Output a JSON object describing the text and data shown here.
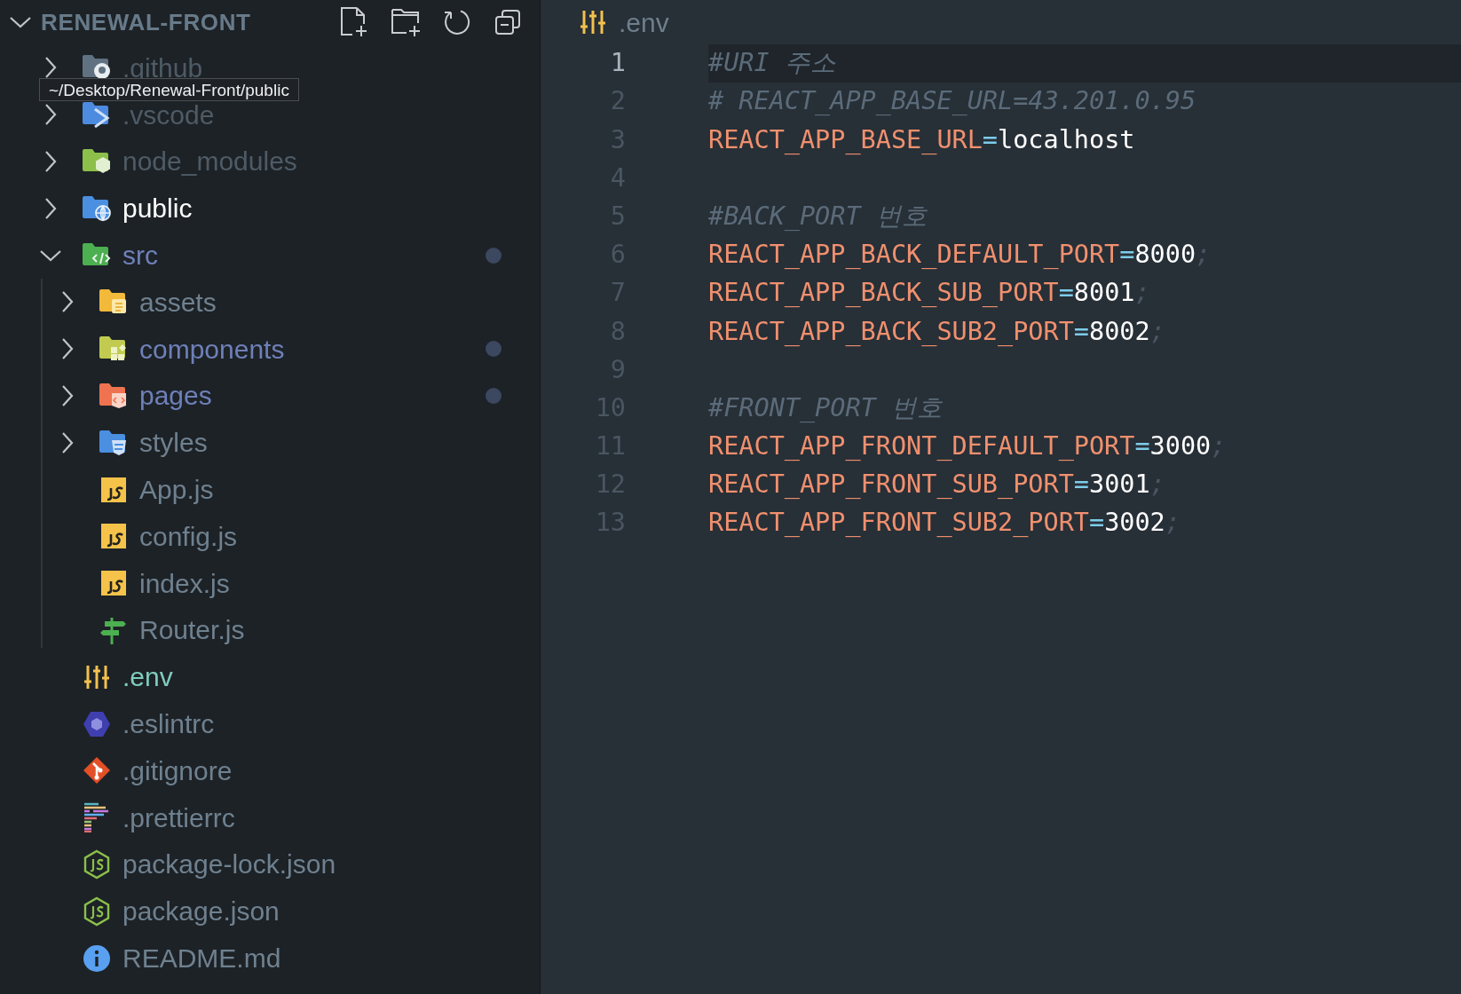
{
  "explorer": {
    "title": "RENEWAL-FRONT",
    "expanded": true
  },
  "tree": [
    {
      "label": ".github",
      "kind": "folder",
      "expanded": false,
      "ignored": true,
      "hovered": false,
      "selected": false,
      "modified": false
    },
    {
      "label": ".vscode",
      "kind": "folder",
      "expanded": false,
      "ignored": true,
      "hovered": false,
      "selected": false,
      "modified": false
    },
    {
      "label": "node_modules",
      "kind": "folder",
      "expanded": false,
      "ignored": true,
      "hovered": false,
      "selected": false,
      "modified": false
    },
    {
      "label": "public",
      "kind": "folder",
      "expanded": false,
      "ignored": false,
      "hovered": true,
      "selected": false,
      "modified": false
    },
    {
      "label": "src",
      "kind": "folder",
      "expanded": true,
      "ignored": false,
      "hovered": false,
      "selected": false,
      "modified": true,
      "children": [
        {
          "label": "assets",
          "kind": "folder",
          "expanded": false,
          "ignored": false,
          "hovered": false,
          "selected": false,
          "modified": false
        },
        {
          "label": "components",
          "kind": "folder",
          "expanded": false,
          "ignored": false,
          "hovered": false,
          "selected": false,
          "modified": true
        },
        {
          "label": "pages",
          "kind": "folder",
          "expanded": false,
          "ignored": false,
          "hovered": false,
          "selected": false,
          "modified": true
        },
        {
          "label": "styles",
          "kind": "folder",
          "expanded": false,
          "ignored": false,
          "hovered": false,
          "selected": false,
          "modified": false
        },
        {
          "label": "App.js",
          "kind": "file",
          "ignored": false,
          "hovered": false,
          "selected": false,
          "modified": false
        },
        {
          "label": "config.js",
          "kind": "file",
          "ignored": false,
          "hovered": false,
          "selected": false,
          "modified": false
        },
        {
          "label": "index.js",
          "kind": "file",
          "ignored": false,
          "hovered": false,
          "selected": false,
          "modified": false
        },
        {
          "label": "Router.js",
          "kind": "file",
          "ignored": false,
          "hovered": false,
          "selected": false,
          "modified": false
        }
      ]
    },
    {
      "label": ".env",
      "kind": "file",
      "ignored": false,
      "hovered": false,
      "selected": true,
      "modified": false
    },
    {
      "label": ".eslintrc",
      "kind": "file",
      "ignored": false,
      "hovered": false,
      "selected": false,
      "modified": false
    },
    {
      "label": ".gitignore",
      "kind": "file",
      "ignored": false,
      "hovered": false,
      "selected": false,
      "modified": false
    },
    {
      "label": ".prettierrc",
      "kind": "file",
      "ignored": false,
      "hovered": false,
      "selected": false,
      "modified": false
    },
    {
      "label": "package-lock.json",
      "kind": "file",
      "ignored": false,
      "hovered": false,
      "selected": false,
      "modified": false
    },
    {
      "label": "package.json",
      "kind": "file",
      "ignored": false,
      "hovered": false,
      "selected": false,
      "modified": false
    },
    {
      "label": "README.md",
      "kind": "file",
      "ignored": false,
      "hovered": false,
      "selected": false,
      "modified": false
    }
  ],
  "tooltip": "~/Desktop/Renewal-Front/public",
  "editor": {
    "tab": ".env",
    "lines": [
      {
        "number": "1",
        "current": true,
        "tokens": [
          {
            "kind": "comment",
            "text": "#URI 주소"
          }
        ]
      },
      {
        "number": "2",
        "current": false,
        "tokens": [
          {
            "kind": "comment",
            "text": "# REACT_APP_BASE_URL=43.201.0.95"
          }
        ]
      },
      {
        "number": "3",
        "current": false,
        "tokens": [
          {
            "kind": "key",
            "text": "REACT_APP_BASE_URL"
          },
          {
            "kind": "op",
            "text": "="
          },
          {
            "kind": "value",
            "text": "localhost"
          }
        ]
      },
      {
        "number": "4",
        "current": false
      },
      {
        "number": "5",
        "current": false,
        "tokens": [
          {
            "kind": "comment",
            "text": "#BACK_PORT 번호"
          }
        ]
      },
      {
        "number": "6",
        "current": false,
        "tokens": [
          {
            "kind": "key",
            "text": "REACT_APP_BACK_DEFAULT_PORT"
          },
          {
            "kind": "op",
            "text": "="
          },
          {
            "kind": "value",
            "text": "8000"
          },
          {
            "kind": "punct",
            "text": ";"
          }
        ]
      },
      {
        "number": "7",
        "current": false,
        "tokens": [
          {
            "kind": "key",
            "text": "REACT_APP_BACK_SUB_PORT"
          },
          {
            "kind": "op",
            "text": "="
          },
          {
            "kind": "value",
            "text": "8001"
          },
          {
            "kind": "punct",
            "text": ";"
          }
        ]
      },
      {
        "number": "8",
        "current": false,
        "tokens": [
          {
            "kind": "key",
            "text": "REACT_APP_BACK_SUB2_PORT"
          },
          {
            "kind": "op",
            "text": "="
          },
          {
            "kind": "value",
            "text": "8002"
          },
          {
            "kind": "punct",
            "text": ";"
          }
        ]
      },
      {
        "number": "9",
        "current": false
      },
      {
        "number": "10",
        "current": false,
        "tokens": [
          {
            "kind": "comment",
            "text": "#FRONT_PORT 번호"
          }
        ]
      },
      {
        "number": "11",
        "current": false,
        "tokens": [
          {
            "kind": "key",
            "text": "REACT_APP_FRONT_DEFAULT_PORT"
          },
          {
            "kind": "op",
            "text": "="
          },
          {
            "kind": "value",
            "text": "3000"
          },
          {
            "kind": "punct",
            "text": ";"
          }
        ]
      },
      {
        "number": "12",
        "current": false,
        "tokens": [
          {
            "kind": "key",
            "text": "REACT_APP_FRONT_SUB_PORT"
          },
          {
            "kind": "op",
            "text": "="
          },
          {
            "kind": "value",
            "text": "3001"
          },
          {
            "kind": "punct",
            "text": ";"
          }
        ]
      },
      {
        "number": "13",
        "current": false,
        "tokens": [
          {
            "kind": "key",
            "text": "REACT_APP_FRONT_SUB2_PORT"
          },
          {
            "kind": "op",
            "text": "="
          },
          {
            "kind": "value",
            "text": "3002"
          },
          {
            "kind": "punct",
            "text": ";"
          }
        ]
      }
    ]
  }
}
